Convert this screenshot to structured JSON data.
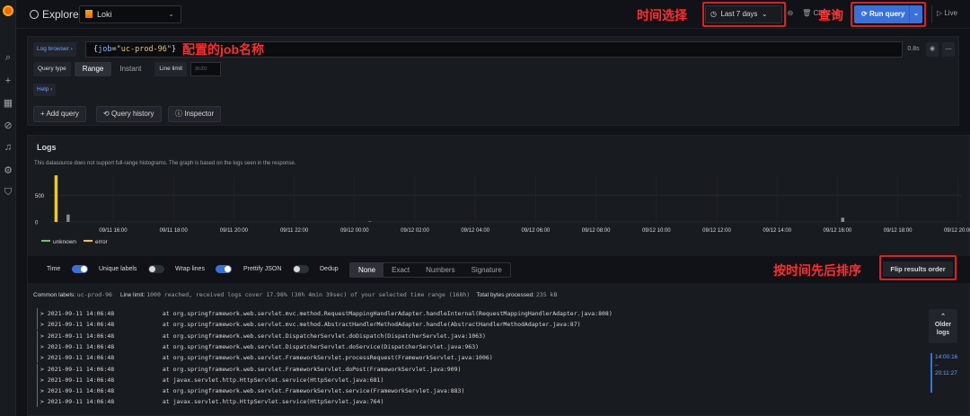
{
  "header": {
    "title": "Explore",
    "datasource": "Loki",
    "time_range": "Last 7 days",
    "clear_label": "Clear all",
    "run_label": "Run query",
    "live_label": "Live"
  },
  "annotations": {
    "time_select": "时间选择",
    "query": "查询",
    "job_name": "配置的job名称",
    "sort_order": "按时间先后排序"
  },
  "query_editor": {
    "log_browser": "Log browser ›",
    "query_label": "job",
    "query_value": "uc-prod-96",
    "duration": "0.8s",
    "query_type_label": "Query type",
    "query_type_options": [
      "Range",
      "Instant"
    ],
    "query_type_selected": "Range",
    "line_limit_label": "Line limit",
    "line_limit_placeholder": "auto",
    "help": "Help ›",
    "add_query": "+ Add query",
    "query_history": "Query history",
    "inspector": "Inspector"
  },
  "logs_panel": {
    "title": "Logs",
    "notice": "This datasource does not support full-range histograms. The graph is based on the logs seen in the response.",
    "legend": [
      {
        "name": "unknown",
        "color": "#73bf69"
      },
      {
        "name": "error",
        "color": "#f2cc0c"
      }
    ],
    "options": {
      "time": {
        "label": "Time",
        "on": true
      },
      "unique_labels": {
        "label": "Unique labels",
        "on": false
      },
      "wrap_lines": {
        "label": "Wrap lines",
        "on": true
      },
      "prettify_json": {
        "label": "Prettify JSON",
        "on": false
      },
      "dedup_label": "Dedup",
      "dedup_options": [
        "None",
        "Exact",
        "Numbers",
        "Signature"
      ],
      "dedup_selected": "None"
    },
    "flip_label": "Flip results order",
    "meta": {
      "common_labels_key": "Common labels:",
      "common_labels_value": "uc-prod-96",
      "line_limit_key": "Line limit:",
      "line_limit_value": "1000 reached, received logs cover 17.98% (30h 4min 39sec) of your selected time range (168h)",
      "processed_key": "Total bytes processed:",
      "processed_value": "235 kB"
    },
    "lines": [
      {
        "ts": "2021-09-11 14:06:48",
        "msg": "at org.springframework.web.servlet.mvc.method.RequestMappingHandlerAdapter.handleInternal(RequestMappingHandlerAdapter.java:808)"
      },
      {
        "ts": "2021-09-11 14:06:48",
        "msg": "at org.springframework.web.servlet.mvc.method.AbstractHandlerMethodAdapter.handle(AbstractHandlerMethodAdapter.java:87)"
      },
      {
        "ts": "2021-09-11 14:06:48",
        "msg": "at org.springframework.web.servlet.DispatcherServlet.doDispatch(DispatcherServlet.java:1063)"
      },
      {
        "ts": "2021-09-11 14:06:48",
        "msg": "at org.springframework.web.servlet.DispatcherServlet.doService(DispatcherServlet.java:963)"
      },
      {
        "ts": "2021-09-11 14:06:48",
        "msg": "at org.springframework.web.servlet.FrameworkServlet.processRequest(FrameworkServlet.java:1006)"
      },
      {
        "ts": "2021-09-11 14:06:48",
        "msg": "at org.springframework.web.servlet.FrameworkServlet.doPost(FrameworkServlet.java:909)"
      },
      {
        "ts": "2021-09-11 14:06:48",
        "msg": "at javax.servlet.http.HttpServlet.service(HttpServlet.java:681)"
      },
      {
        "ts": "2021-09-11 14:06:48",
        "msg": "at org.springframework.web.servlet.FrameworkServlet.service(FrameworkServlet.java:883)"
      },
      {
        "ts": "2021-09-11 14:06:48",
        "msg": "at javax.servlet.http.HttpServlet.service(HttpServlet.java:764)"
      }
    ],
    "older_logs": "Older logs",
    "range_top": "14:00:16",
    "range_sep": "–",
    "range_bottom": "20:11:27"
  },
  "chart_data": {
    "type": "bar",
    "title": "",
    "ylabel": "",
    "y_ticks": [
      0,
      500
    ],
    "ylim": [
      0,
      900
    ],
    "x_ticks": [
      "09/11 16:00",
      "09/11 18:00",
      "09/11 20:00",
      "09/11 22:00",
      "09/12 00:00",
      "09/12 02:00",
      "09/12 04:00",
      "09/12 06:00",
      "09/12 08:00",
      "09/12 10:00",
      "09/12 12:00",
      "09/12 14:00",
      "09/12 16:00",
      "09/12 18:00",
      "09/12 20:00"
    ],
    "series": [
      {
        "name": "unknown",
        "color": "#73bf69",
        "points": [
          {
            "x": "09/11 14:06",
            "y": 880
          },
          {
            "x": "09/11 14:30",
            "y": 140
          },
          {
            "x": "09/12 00:30",
            "y": 10
          },
          {
            "x": "09/12 16:10",
            "y": 80
          }
        ]
      },
      {
        "name": "error",
        "color": "#f2cc0c",
        "points": []
      }
    ]
  }
}
